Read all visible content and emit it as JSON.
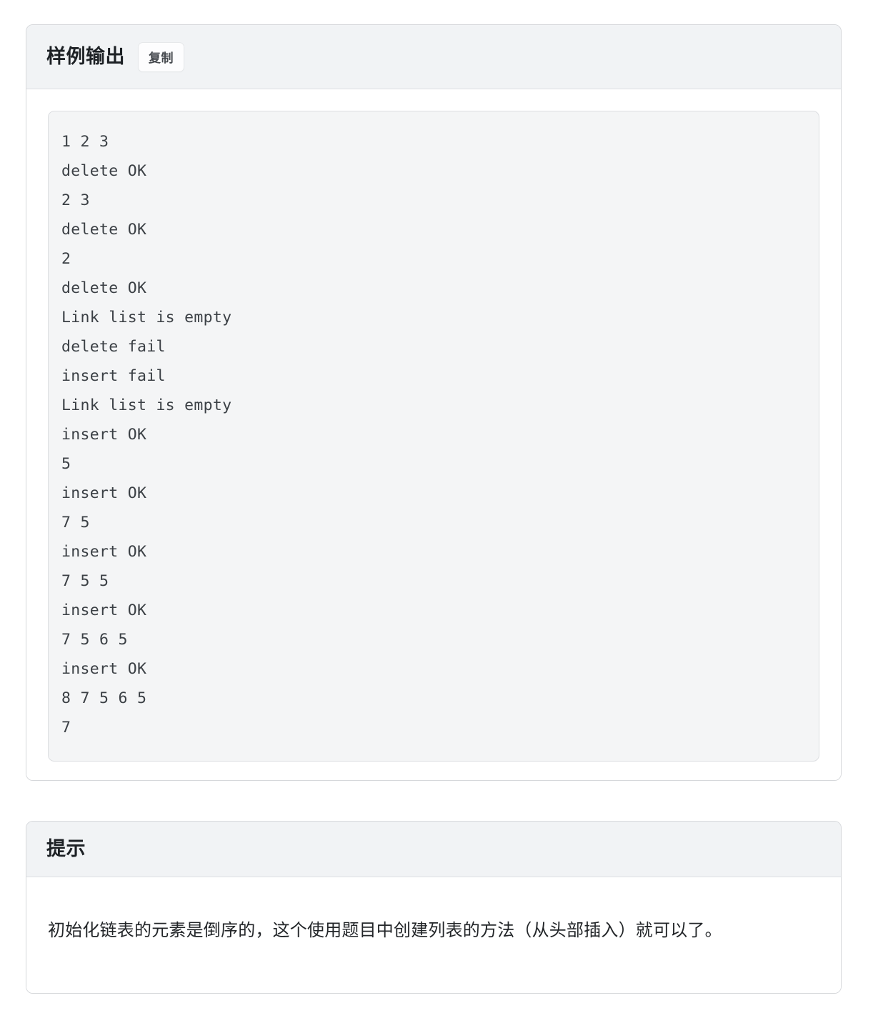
{
  "sample_output_card": {
    "title": "样例输出",
    "copy_label": "复制",
    "code_lines": [
      "1 2 3",
      "delete OK",
      "2 3",
      "delete OK",
      "2",
      "delete OK",
      "Link list is empty",
      "delete fail",
      "insert fail",
      "Link list is empty",
      "insert OK",
      "5",
      "insert OK",
      "7 5",
      "insert OK",
      "7 5 5",
      "insert OK",
      "7 5 6 5",
      "insert OK",
      "8 7 5 6 5",
      "7"
    ],
    "code_text": "1 2 3\ndelete OK\n2 3\ndelete OK\n2\ndelete OK\nLink list is empty\ndelete fail\ninsert fail\nLink list is empty\ninsert OK\n5\ninsert OK\n7 5\ninsert OK\n7 5 5\ninsert OK\n7 5 6 5\ninsert OK\n8 7 5 6 5\n7"
  },
  "hint_card": {
    "title": "提示",
    "body": "初始化链表的元素是倒序的，这个使用题目中创建列表的方法（从头部插入）就可以了。"
  },
  "colors": {
    "page_background": "#ffffff",
    "card_border": "#d6d8db",
    "card_header_background": "#f1f3f5",
    "code_background": "#f4f5f6",
    "code_border": "#dcdee1",
    "code_text": "#3b4045",
    "title_text": "#1d2125",
    "body_text": "#232629",
    "button_text": "#45494e"
  }
}
